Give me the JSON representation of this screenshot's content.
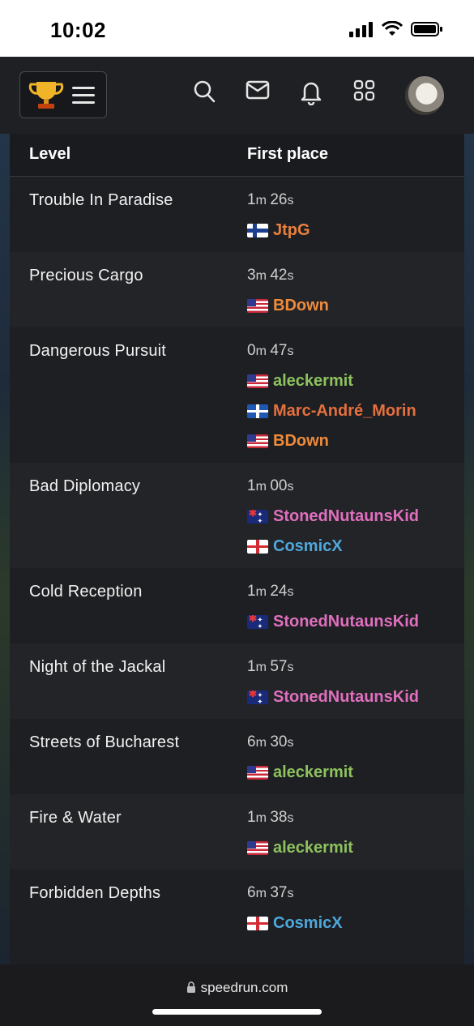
{
  "status_bar": {
    "time": "10:02"
  },
  "nav": {
    "icons": [
      "trophy-icon",
      "menu-icon",
      "search-icon",
      "mail-icon",
      "bell-icon",
      "grid-icon"
    ]
  },
  "table": {
    "headers": {
      "level": "Level",
      "first_place": "First place"
    },
    "rows": [
      {
        "level": "Trouble In Paradise",
        "time": {
          "m": "1",
          "s": "26"
        },
        "runners": [
          {
            "name": "JtpG",
            "flag": "fi",
            "color": "#e8813f"
          }
        ]
      },
      {
        "level": "Precious Cargo",
        "time": {
          "m": "3",
          "s": "42"
        },
        "runners": [
          {
            "name": "BDown",
            "flag": "us",
            "color": "#ee8a3c"
          }
        ]
      },
      {
        "level": "Dangerous Pursuit",
        "time": {
          "m": "0",
          "s": "47"
        },
        "runners": [
          {
            "name": "aleckermit",
            "flag": "us",
            "color": "#8dc25e"
          },
          {
            "name": "Marc-André_Morin",
            "flag": "qc",
            "color": "#e5703f"
          },
          {
            "name": "BDown",
            "flag": "us",
            "color": "#ee8a3c"
          }
        ]
      },
      {
        "level": "Bad Diplomacy",
        "time": {
          "m": "1",
          "s": "00"
        },
        "runners": [
          {
            "name": "StonedNutaunsKid",
            "flag": "au",
            "color": "#e06fbf"
          },
          {
            "name": "CosmicX",
            "flag": "gb",
            "color": "#4fa8dd"
          }
        ]
      },
      {
        "level": "Cold Reception",
        "time": {
          "m": "1",
          "s": "24"
        },
        "runners": [
          {
            "name": "StonedNutaunsKid",
            "flag": "au",
            "color": "#e06fbf"
          }
        ]
      },
      {
        "level": "Night of the Jackal",
        "time": {
          "m": "1",
          "s": "57"
        },
        "runners": [
          {
            "name": "StonedNutaunsKid",
            "flag": "au",
            "color": "#e06fbf"
          }
        ]
      },
      {
        "level": "Streets of Bucharest",
        "time": {
          "m": "6",
          "s": "30"
        },
        "runners": [
          {
            "name": "aleckermit",
            "flag": "us",
            "color": "#8dc25e"
          }
        ]
      },
      {
        "level": "Fire & Water",
        "time": {
          "m": "1",
          "s": "38"
        },
        "runners": [
          {
            "name": "aleckermit",
            "flag": "us",
            "color": "#8dc25e"
          }
        ]
      },
      {
        "level": "Forbidden Depths",
        "time": {
          "m": "6",
          "s": "37"
        },
        "runners": [
          {
            "name": "CosmicX",
            "flag": "gb",
            "color": "#4fa8dd"
          }
        ]
      }
    ]
  },
  "address_bar": {
    "url": "speedrun.com"
  },
  "units": {
    "m": "m",
    "s": "s"
  }
}
